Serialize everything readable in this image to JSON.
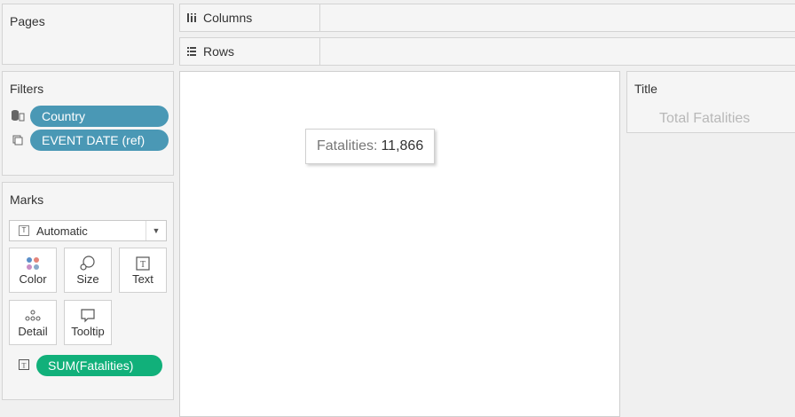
{
  "pages": {
    "title": "Pages"
  },
  "columns": {
    "icon": "columns-icon",
    "label": "Columns"
  },
  "rows": {
    "icon": "rows-icon",
    "label": "Rows"
  },
  "filters": {
    "title": "Filters",
    "items": [
      {
        "label": "Country",
        "icon": "database-filter-icon"
      },
      {
        "label": "EVENT DATE (ref)",
        "icon": "copy-filter-icon"
      }
    ]
  },
  "marks": {
    "title": "Marks",
    "type": "Automatic",
    "buttons": [
      {
        "label": "Color",
        "icon": "color-icon"
      },
      {
        "label": "Size",
        "icon": "size-icon"
      },
      {
        "label": "Text",
        "icon": "text-icon"
      },
      {
        "label": "Detail",
        "icon": "detail-icon"
      },
      {
        "label": "Tooltip",
        "icon": "tooltip-icon"
      }
    ],
    "pill": "SUM(Fatalities)",
    "colors": {
      "filter_pill": "#4a98b5",
      "measure_pill": "#11b07a"
    }
  },
  "view": {
    "tooltip": {
      "key": "Fatalities:",
      "value": "11,866"
    }
  },
  "title_card": {
    "title": "Title",
    "text": "Total Fatalities"
  }
}
